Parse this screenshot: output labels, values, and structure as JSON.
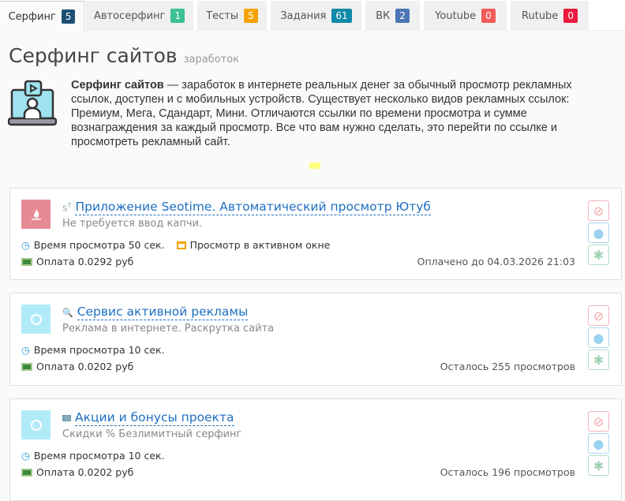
{
  "tabs": [
    {
      "label": "Серфинг",
      "count": "5",
      "color": "#1d4f73"
    },
    {
      "label": "Автосерфинг",
      "count": "1",
      "color": "#3cc194"
    },
    {
      "label": "Тесты",
      "count": "5",
      "color": "#f5a300"
    },
    {
      "label": "Задания",
      "count": "61",
      "color": "#1189a8"
    },
    {
      "label": "ВК",
      "count": "2",
      "color": "#4a76b4"
    },
    {
      "label": "Youtube",
      "count": "0",
      "color": "#f55a5a"
    },
    {
      "label": "Rutube",
      "count": "0",
      "color": "#ec1a3c"
    }
  ],
  "page": {
    "title": "Серфинг сайтов",
    "subtitle": "заработок",
    "intro_bold": "Серфинг сайтов",
    "intro_text": " — заработок в интернете реальных денег за обычный просмотр рекламных ссылок, доступен и с мобильных устройств. Существует несколько видов рекламных ссылок: Премиум, Мега, Сдандарт, Мини. Отличаются ссылки по времени просмотра и сумме вознаграждения за каждый просмотр. Все что вам нужно сделать, это перейти по ссылке и просмотреть рекламный сайт."
  },
  "cards": [
    {
      "title": "Приложение Seotime. Автоматический просмотр Ютуб",
      "subtitle": "Не требуется ввод капчи.",
      "time": "Время просмотра 50 сек.",
      "active_window": "Просмотр в активном окне",
      "pay": "Оплата 0.0292 руб",
      "status": "Оплачено до 04.03.2026 21:03"
    },
    {
      "title": "Сервис активной рекламы",
      "subtitle": "Реклама в интернете. Раскрутка сайта",
      "time": "Время просмотра 10 сек.",
      "pay": "Оплата 0.0202 руб",
      "status": "Осталось 255 просмотров"
    },
    {
      "title": "Акции и бонусы проекта",
      "subtitle": "Скидки % Безлимитный серфинг",
      "time": "Время просмотра 10 сек.",
      "pay": "Оплата 0.0202 руб",
      "status": "Осталось 196 просмотров"
    }
  ]
}
